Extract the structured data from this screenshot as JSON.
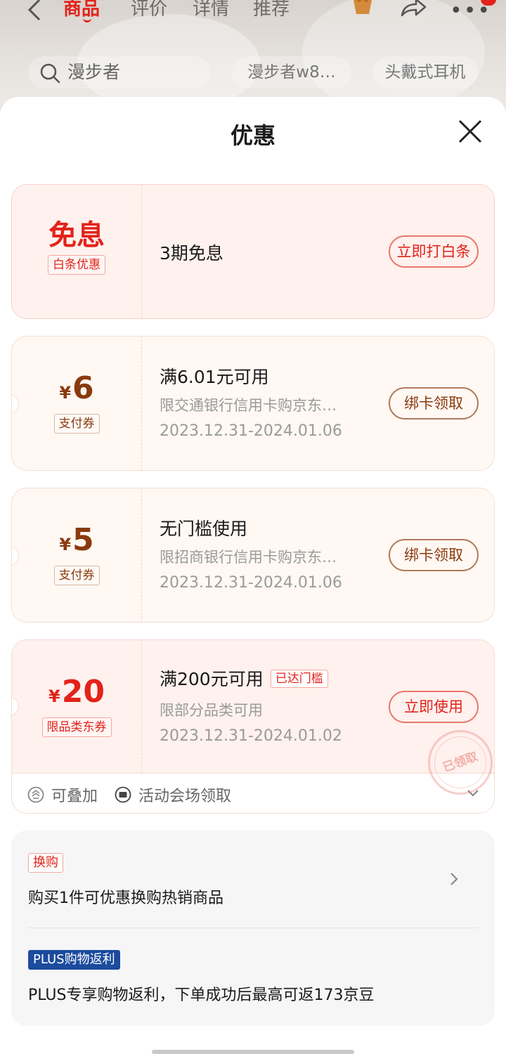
{
  "nav": {
    "tabs": [
      "商品",
      "评价",
      "详情",
      "推荐"
    ],
    "search_placeholder": "漫步者",
    "chips": [
      "漫步者w8…",
      "头戴式耳机"
    ]
  },
  "sheet": {
    "title": "优惠"
  },
  "coupons": [
    {
      "amount": "免息",
      "type_tag": "白条优惠",
      "main": "3期免息",
      "button": "立即打白条"
    },
    {
      "currency": "¥",
      "amount": "6",
      "type_tag": "支付券",
      "main": "满6.01元可用",
      "sub": "限交通银行信用卡购京东…",
      "date": "2023.12.31-2024.01.06",
      "button": "绑卡领取"
    },
    {
      "currency": "¥",
      "amount": "5",
      "type_tag": "支付券",
      "main": "无门槛使用",
      "sub": "限招商银行信用卡购京东…",
      "date": "2023.12.31-2024.01.06",
      "button": "绑卡领取"
    },
    {
      "currency": "¥",
      "amount": "20",
      "type_tag": "限品类东券",
      "main": "满200元可用",
      "status_tag": "已达门槛",
      "sub": "限部分品类可用",
      "date": "2023.12.31-2024.01.02",
      "button": "立即使用",
      "stamp": "已领取"
    }
  ],
  "coupon_features": {
    "stackable": "可叠加",
    "venue": "活动会场领取"
  },
  "extra": {
    "swap_tag": "换购",
    "swap_text": "购买1件可优惠换购热销商品",
    "plus_tag": "PLUS购物返利",
    "plus_text": "PLUS专享购物返利，下单成功后最高可返173京豆"
  },
  "colors": {
    "accent_red": "#e2231a",
    "coupon_brown": "#8a3a0d",
    "plus_blue": "#1c4b9e"
  }
}
